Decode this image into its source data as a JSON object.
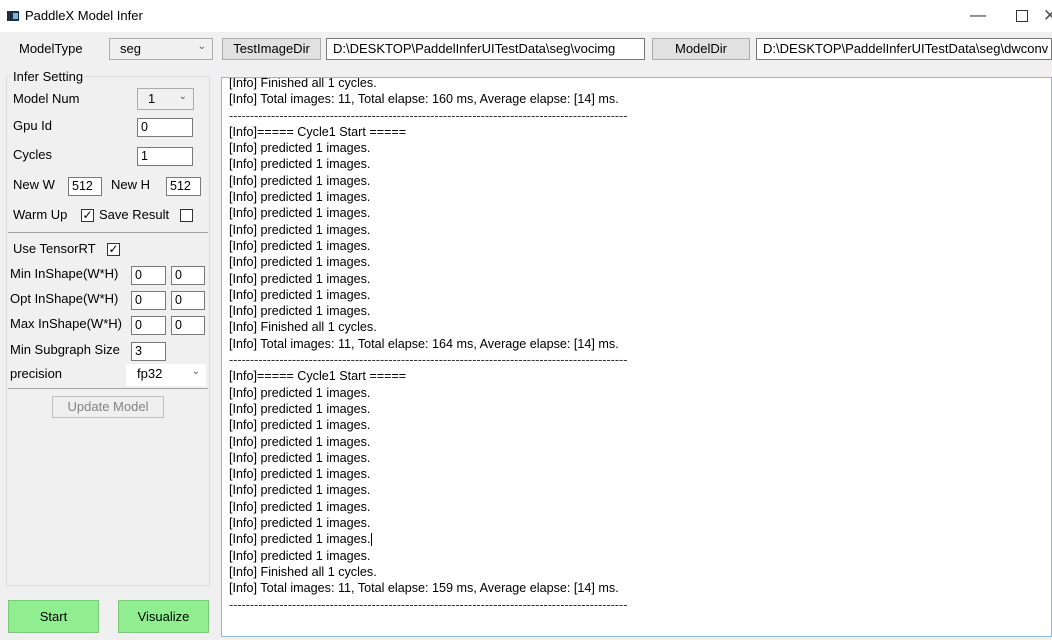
{
  "window": {
    "title": "PaddleX Model Infer",
    "min_glyph": "—",
    "close_glyph": "✕"
  },
  "topbar": {
    "model_type_label": "ModelType",
    "model_type_value": "seg",
    "test_image_dir_button": "TestImageDir",
    "test_image_dir_value": "D:\\DESKTOP\\PaddelInferUITestData\\seg\\vocimg",
    "model_dir_button": "ModelDir",
    "model_dir_value": "D:\\DESKTOP\\PaddelInferUITestData\\seg\\dwconv"
  },
  "settings": {
    "group_title": "Infer Setting",
    "model_num_label": "Model Num",
    "model_num_value": "1",
    "gpu_id_label": "Gpu Id",
    "gpu_id_value": "0",
    "cycles_label": "Cycles",
    "cycles_value": "1",
    "new_w_label": "New W",
    "new_w_value": "512",
    "new_h_label": "New H",
    "new_h_value": "512",
    "warm_up_label": "Warm Up",
    "warm_up_checked": true,
    "save_result_label": "Save Result",
    "save_result_checked": false,
    "use_tensorrt_label": "Use TensorRT",
    "use_tensorrt_checked": true,
    "min_inshape_label": "Min InShape(W*H)",
    "min_inshape_w": "0",
    "min_inshape_h": "0",
    "opt_inshape_label": "Opt InShape(W*H)",
    "opt_inshape_w": "0",
    "opt_inshape_h": "0",
    "max_inshape_label": "Max InShape(W*H)",
    "max_inshape_w": "0",
    "max_inshape_h": "0",
    "min_subgraph_label": "Min Subgraph Size",
    "min_subgraph_value": "3",
    "precision_label": "precision",
    "precision_value": "fp32",
    "update_model_button": "Update Model",
    "check_glyph": "✓"
  },
  "actions": {
    "start_button": "Start",
    "visualize_button": "Visualize"
  },
  "colors": {
    "action_green": "#90ee90",
    "log_border": "#8fb6df"
  },
  "log": {
    "lines": [
      "[Info] Finished all 1 cycles.",
      "[Info] Total images: 11, Total elapse: 160 ms, Average elapse: [14] ms.",
      "-----------------------------------------------------------------------------------------------",
      "[Info]===== Cycle1 Start =====",
      "[Info] predicted 1 images.",
      "[Info] predicted 1 images.",
      "[Info] predicted 1 images.",
      "[Info] predicted 1 images.",
      "[Info] predicted 1 images.",
      "[Info] predicted 1 images.",
      "[Info] predicted 1 images.",
      "[Info] predicted 1 images.",
      "[Info] predicted 1 images.",
      "[Info] predicted 1 images.",
      "[Info] predicted 1 images.",
      "[Info] Finished all 1 cycles.",
      "[Info] Total images: 11, Total elapse: 164 ms, Average elapse: [14] ms.",
      "-----------------------------------------------------------------------------------------------",
      "[Info]===== Cycle1 Start =====",
      "[Info] predicted 1 images.",
      "[Info] predicted 1 images.",
      "[Info] predicted 1 images.",
      "[Info] predicted 1 images.",
      "[Info] predicted 1 images.",
      "[Info] predicted 1 images.",
      "[Info] predicted 1 images.",
      "[Info] predicted 1 images.",
      "[Info] predicted 1 images.",
      "[Info] predicted 1 images.",
      "[Info] predicted 1 images.",
      "[Info] Finished all 1 cycles.",
      "[Info] Total images: 11, Total elapse: 159 ms, Average elapse: [14] ms.",
      "-----------------------------------------------------------------------------------------------"
    ]
  }
}
